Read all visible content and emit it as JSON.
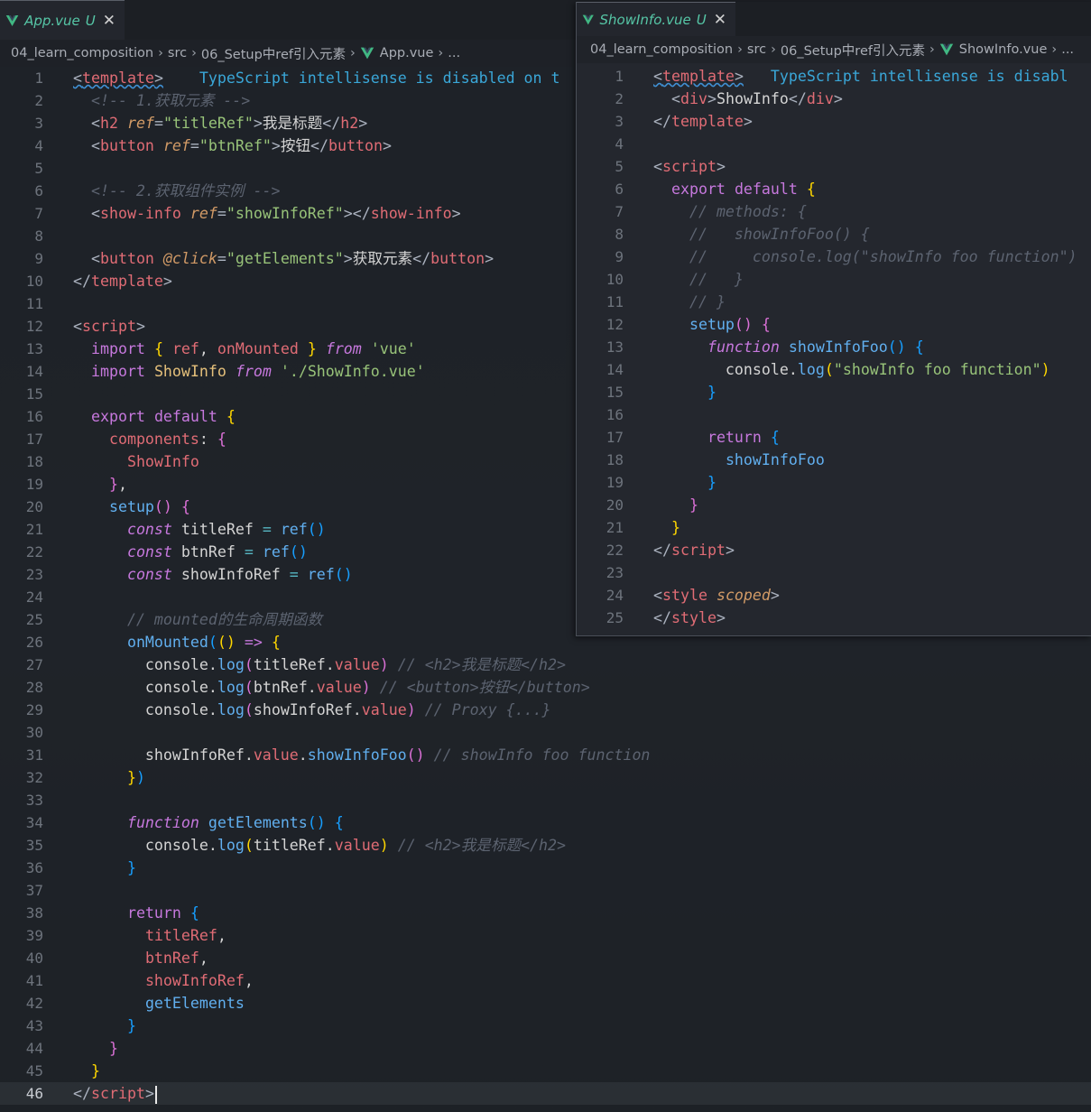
{
  "left_editor": {
    "tab": {
      "filename": "App.vue",
      "status": "U"
    },
    "breadcrumb": [
      "04_learn_composition",
      "src",
      "06_Setup中ref引入元素",
      "App.vue",
      "..."
    ],
    "hint": "TypeScript intellisense is disabled on t",
    "active_line": 46
  },
  "right_editor": {
    "tab": {
      "filename": "ShowInfo.vue",
      "status": "U"
    },
    "breadcrumb": [
      "04_learn_composition",
      "src",
      "06_Setup中ref引入元素",
      "ShowInfo.vue",
      "..."
    ],
    "hint": "TypeScript intellisense is disabl"
  },
  "colors": {
    "vue_green": "#41b883",
    "hint_blue": "#3aa7d8",
    "keyword": "#c678dd",
    "tag": "#e06c75",
    "string": "#98c379",
    "function": "#61afef",
    "comment": "#5c6370"
  },
  "icons": [
    "vue-icon",
    "close-icon",
    "chevron-right-icon"
  ]
}
